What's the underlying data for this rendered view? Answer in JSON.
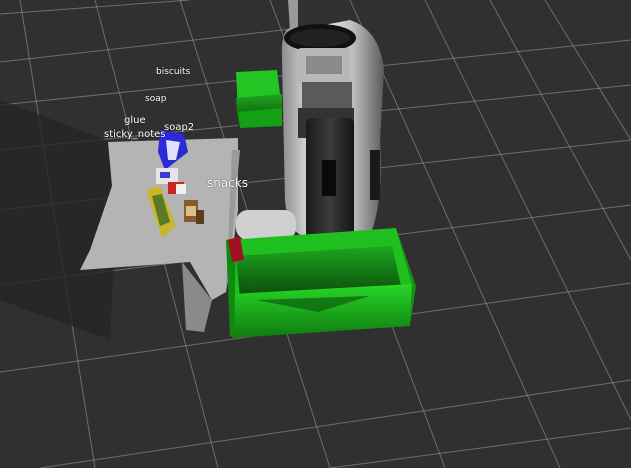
{
  "viewport": {
    "background": "#303030",
    "grid_color": "#a0a0a0",
    "table_color": "#b4b4b4",
    "bin_color": "#22c522",
    "robot_color": "#e6e6e6"
  },
  "object_labels": {
    "biscuits": "biscuits",
    "soap": "soap",
    "glue": "glue",
    "sticky_notes": "sticky_notes",
    "soap2": "soap2",
    "snacks": "snacks"
  }
}
